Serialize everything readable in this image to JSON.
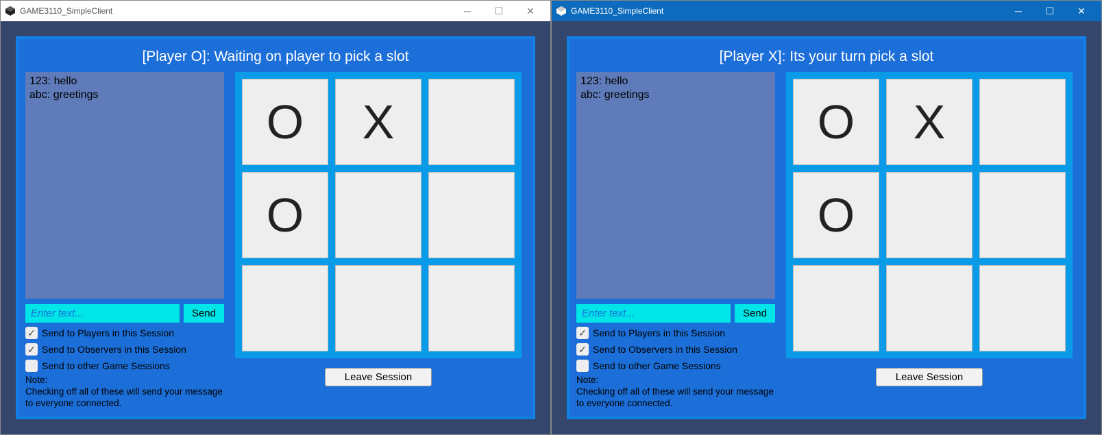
{
  "windows": [
    {
      "title": "GAME3110_SimpleClient",
      "active": false,
      "status": "[Player O]: Waiting on player to pick a slot",
      "chat": [
        "123: hello",
        "abc: greetings"
      ],
      "input_placeholder": "Enter text...",
      "send_label": "Send",
      "checks": [
        {
          "label": "Send to Players in this Session",
          "checked": true
        },
        {
          "label": "Send to Observers in this Session",
          "checked": true
        },
        {
          "label": "Send to other Game Sessions",
          "checked": false
        }
      ],
      "note_title": "Note:",
      "note_body": "Checking off all of these will send your message to everyone connected.",
      "board": [
        "O",
        "X",
        "",
        "O",
        "",
        "",
        "",
        "",
        ""
      ],
      "leave_label": "Leave Session"
    },
    {
      "title": "GAME3110_SimpleClient",
      "active": true,
      "status": "[Player X]: Its your turn pick a slot",
      "chat": [
        "123: hello",
        "abc: greetings"
      ],
      "input_placeholder": "Enter text...",
      "send_label": "Send",
      "checks": [
        {
          "label": "Send to Players in this Session",
          "checked": true
        },
        {
          "label": "Send to Observers in this Session",
          "checked": true
        },
        {
          "label": "Send to other Game Sessions",
          "checked": false
        }
      ],
      "note_title": "Note:",
      "note_body": "Checking off all of these will send your message to everyone connected.",
      "board": [
        "O",
        "X",
        "",
        "O",
        "",
        "",
        "",
        "",
        ""
      ],
      "leave_label": "Leave Session"
    }
  ]
}
